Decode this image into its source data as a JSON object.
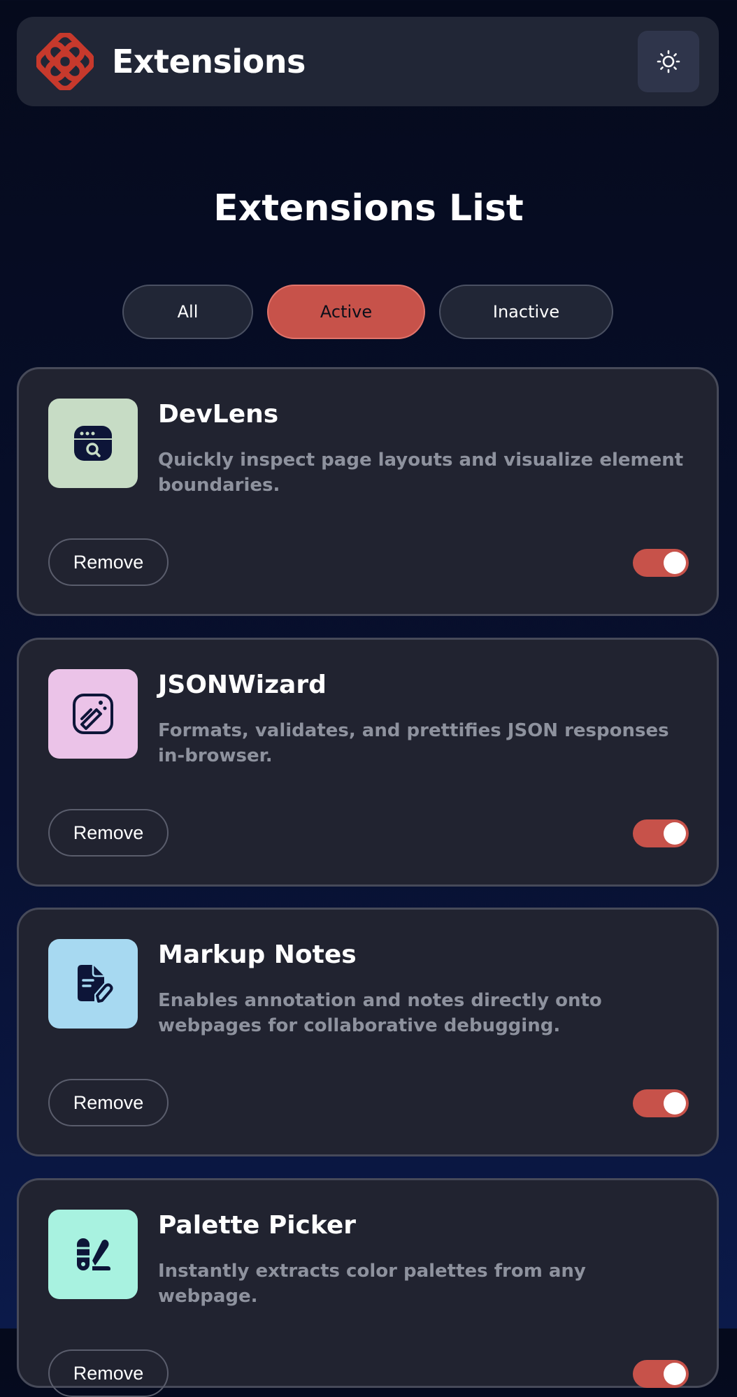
{
  "header": {
    "title": "Extensions",
    "logo_icon": "flower-logo-icon",
    "theme_icon": "sun-icon"
  },
  "main": {
    "title": "Extensions List",
    "filters": [
      {
        "label": "All",
        "selected": false
      },
      {
        "label": "Active",
        "selected": true
      },
      {
        "label": "Inactive",
        "selected": false
      }
    ]
  },
  "extensions": [
    {
      "name": "DevLens",
      "description": "Quickly inspect page layouts and visualize element boundaries.",
      "icon": "browser-search-icon",
      "icon_bg": "#c7dcc5",
      "remove_label": "Remove",
      "active": true
    },
    {
      "name": "JSONWizard",
      "description": "Formats, validates, and prettifies JSON responses in-browser.",
      "icon": "magic-wand-icon",
      "icon_bg": "#ebc3e8",
      "remove_label": "Remove",
      "active": true
    },
    {
      "name": "Markup Notes",
      "description": "Enables annotation and notes directly onto webpages for collaborative debugging.",
      "icon": "document-pen-icon",
      "icon_bg": "#a7d9f1",
      "remove_label": "Remove",
      "active": true
    },
    {
      "name": "Palette Picker",
      "description": "Instantly extracts color palettes from any webpage.",
      "icon": "palette-icon",
      "icon_bg": "#a8f2e0",
      "remove_label": "Remove",
      "active": true
    }
  ],
  "colors": {
    "accent": "#c7524a",
    "card_bg": "#212330",
    "header_bg": "#212636",
    "icon_ink": "#0d1538"
  }
}
